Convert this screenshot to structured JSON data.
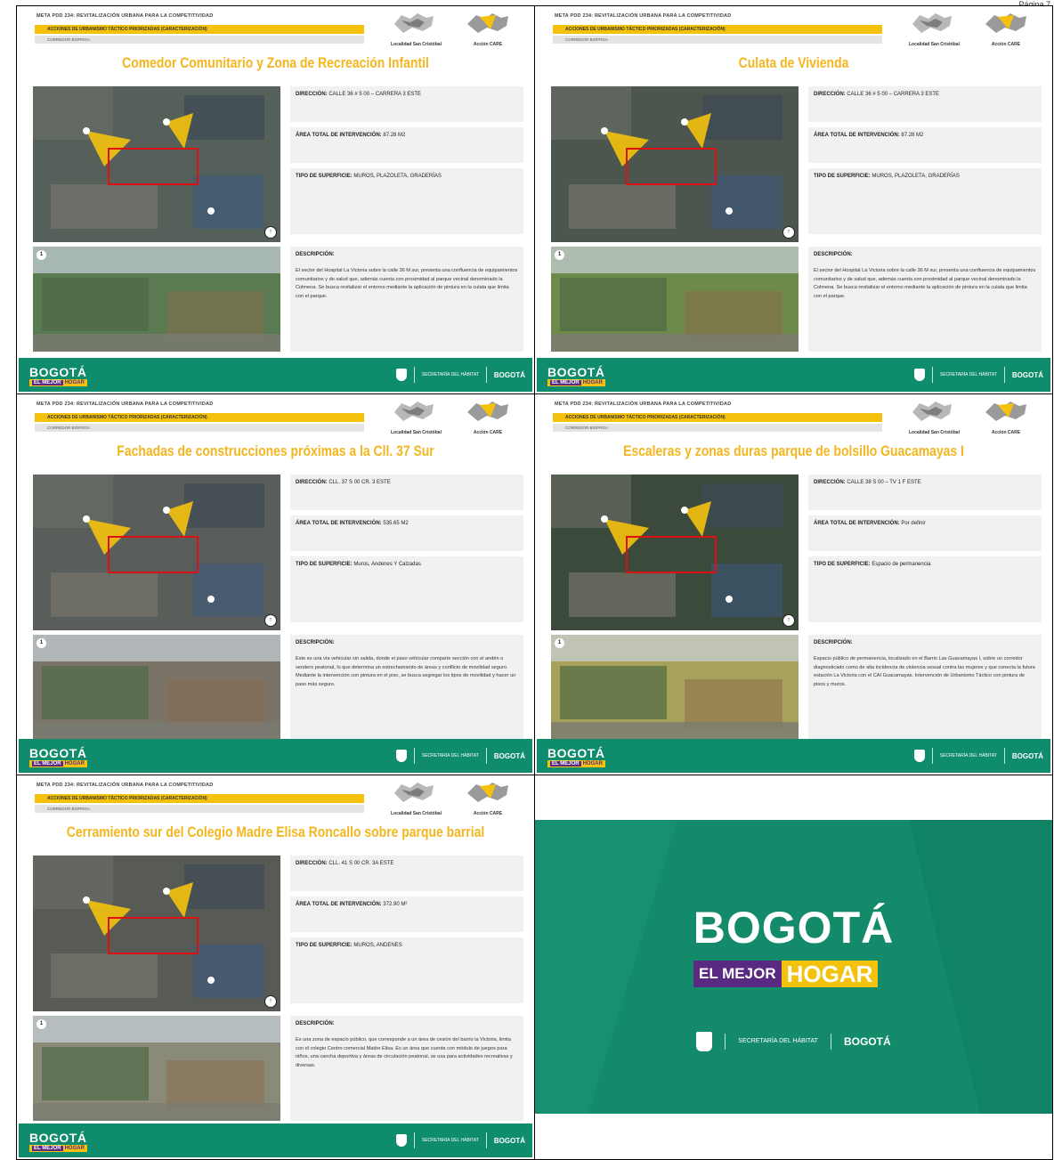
{
  "page_number": "Página 7",
  "common": {
    "meta": "META PDD 234: REVITALIZACIÓN URBANA PARA LA COMPETITIVIDAD",
    "band": "ACCIONES DE URBANISMO TÁCTICO PRIORIZADAS (CARACTERIZACIÓN)",
    "band2": "CORREDOR BIOPROA",
    "logo1_label": "Localidad San Cristóbal",
    "logo2_label": "Acción CARE",
    "lbl_direccion": "DIRECCIÓN:",
    "lbl_area": "ÁREA TOTAL DE INTERVENCIÓN:",
    "lbl_tipo": "TIPO DE SUPERFICIE:",
    "lbl_descripcion": "DESCRIPCIÓN:",
    "footer_brand": "BOGOTÁ",
    "footer_sub_a": "EL MEJOR",
    "footer_sub_b": "HOGAR",
    "footer_habitat": "SECRETARÍA DEL HÁBITAT",
    "footer_bogota": "BOGOTÁ"
  },
  "slides": [
    {
      "title": "Comedor Comunitario y Zona de Recreación Infantil",
      "direccion": "CALLE 36 # 5 00 – CARRERA 3 ESTE",
      "area": "87.28 M2",
      "tipo": "MUROS, PLAZOLETA, GRADERÍAS",
      "descripcion": "El sector del Hospital La Victoria sobre la calle 36 M sur, presenta una confluencia de equipamientos comunitarios y de salud que, además cuenta con proximidad al parque vecinal denominado la Colmena. Se busca revitalizar el entorno mediante la aplicación de pintura en la culata que limita con el parque.",
      "map_color": "#56605a",
      "photo_color": "#5a7b52"
    },
    {
      "title": "Culata de Vivienda",
      "direccion": "CALLE 36 # 5 00 – CARRERA 3 ESTE",
      "area": "87.28 M2",
      "tipo": "MUROS, PLAZOLETA, GRADERÍAS",
      "descripcion": "El sector del Hospital La Victoria sobre la calle 36 M sur, presenta una confluencia de equipamientos comunitarios y de salud que, además cuenta con proximidad al parque vecinal denominado la Colmena. Se busca revitalizar el entorno mediante la aplicación de pintura en la culata que limita con el parque.",
      "map_color": "#4d564e",
      "photo_color": "#6e8a4a"
    },
    {
      "title": "Fachadas de construcciones próximas a la Cll. 37 Sur",
      "direccion": "CLL. 37 S 00 CR. 3 ESTE",
      "area": "535.65 M2",
      "tipo": "Muros, Andenes Y Calzadas",
      "descripcion": "Este es una vía vehicular sin salida, donde el paso vehicular comparte sección con el andén o sendero peatonal, lo que determina un estrechamiento de áreas y conflicto de movilidad seguro. Mediante la intervención con pintura en el piso, se busca segregar los tipos de movilidad y hacer un paso más seguro.",
      "map_color": "#5a5e5a",
      "photo_color": "#7a7468"
    },
    {
      "title": "Escaleras y zonas duras parque de bolsillo Guacamayas I",
      "direccion": "CALLE 38 S 00 – TV 1 F ESTE",
      "area": "Por definir",
      "tipo": "Espacio de permanencia",
      "descripcion": "Espacio público de permanencia, localizado en el Barrio Las Guacamayas I, sobre un corredor diagnosticado como de alta incidencia de violencia sexual contra las mujeres y que conecta la futura estación La Victoria con el CAI Guacamayas. Intervención de Urbanismo Táctico con pintura de pisos y muros.",
      "map_color": "#3c4a3c",
      "photo_color": "#a7a15a"
    },
    {
      "title": "Cerramiento sur del Colegio Madre Elisa Roncallo sobre parque barrial",
      "direccion": "CLL. 41 S 00 CR. 3A ESTE",
      "area": "372.90 M²",
      "tipo": "MUROS, ANDENES",
      "descripcion": "Es una zona de espacio público, que corresponde a un área de cesión del barrio la Victoria, limita con el colegio Centro comercial Madre Elisa. Es un área que cuenta con módulo de juegos para niños, una cancha deportiva y áreas de circulación peatonal, se usa para actividades recreativas y diversas.",
      "map_color": "#585a56",
      "photo_color": "#8a8a78"
    }
  ],
  "cover": {
    "title": "BOGOTÁ",
    "sub_a": "EL MEJOR",
    "sub_b": "HOGAR",
    "habitat": "SECRETARÍA DEL HÁBITAT",
    "bogota": "BOGOTÁ"
  }
}
